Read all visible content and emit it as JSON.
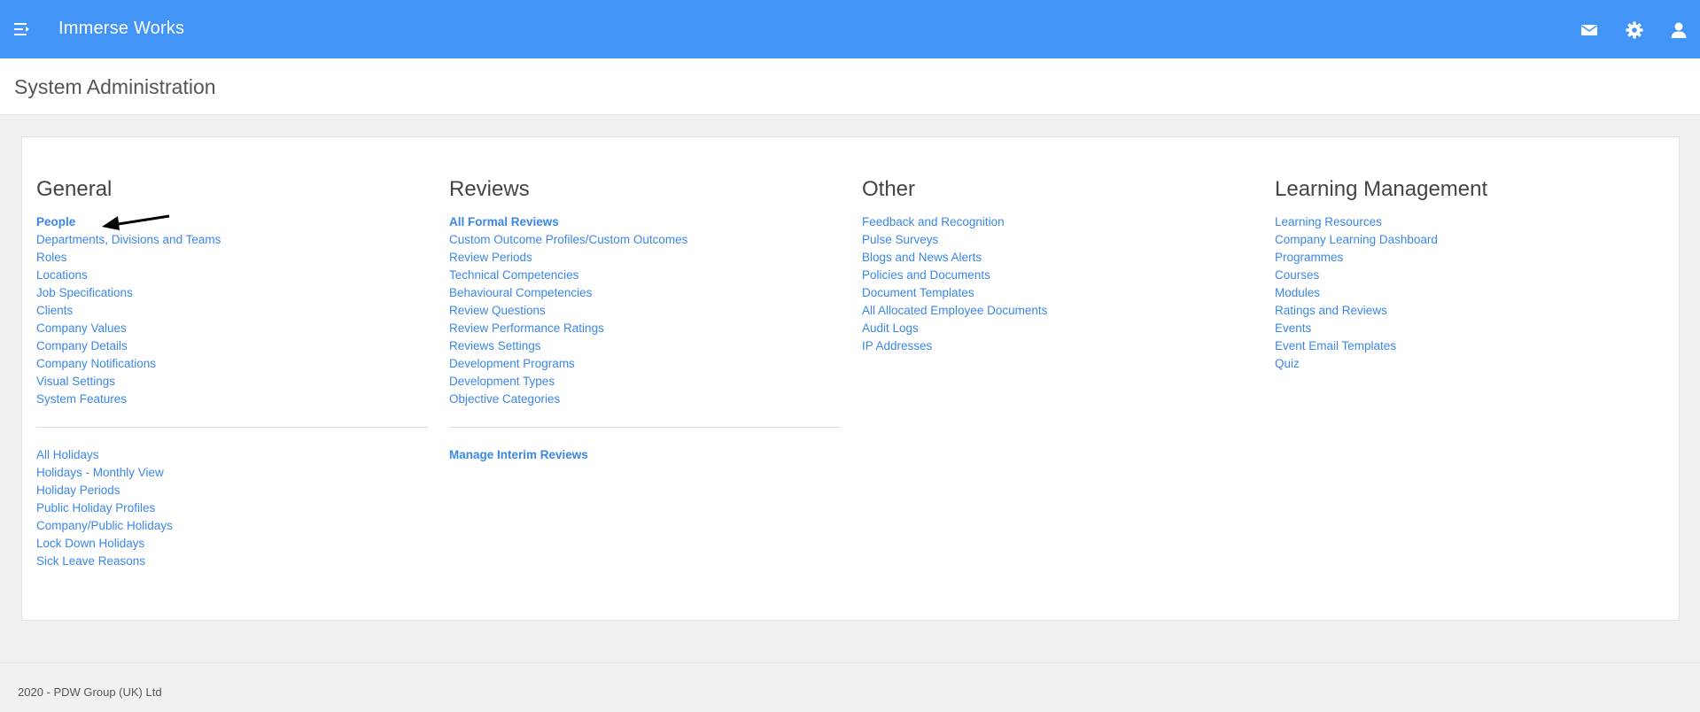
{
  "header": {
    "app_title": "Immerse Works",
    "icons": [
      "menu-icon",
      "mail-icon",
      "gear-icon",
      "user-icon"
    ],
    "bg_color": "#4294f7"
  },
  "page": {
    "title": "System Administration"
  },
  "columns": {
    "general": {
      "heading": "General",
      "links": [
        "People",
        "Departments, Divisions and Teams",
        "Roles",
        "Locations",
        "Job Specifications",
        "Clients",
        "Company Values",
        "Company Details",
        "Company Notifications",
        "Visual Settings",
        "System Features"
      ],
      "links2": [
        "All Holidays",
        "Holidays - Monthly View",
        "Holiday Periods",
        "Public Holiday Profiles",
        "Company/Public Holidays",
        "Lock Down Holidays",
        "Sick Leave Reasons"
      ]
    },
    "reviews": {
      "heading": "Reviews",
      "links": [
        "All Formal Reviews",
        "Custom Outcome Profiles/Custom Outcomes",
        "Review Periods",
        "Technical Competencies",
        "Behavioural Competencies",
        "Review Questions",
        "Review Performance Ratings",
        "Reviews Settings",
        "Development Programs",
        "Development Types",
        "Objective Categories"
      ],
      "links2": [
        "Manage Interim Reviews"
      ]
    },
    "other": {
      "heading": "Other",
      "links": [
        "Feedback and Recognition",
        "Pulse Surveys",
        "Blogs and News Alerts",
        "Policies and Documents",
        "Document Templates",
        "All Allocated Employee Documents",
        "Audit Logs",
        "IP Addresses"
      ]
    },
    "learning": {
      "heading": "Learning Management",
      "links": [
        "Learning Resources",
        "Company Learning Dashboard",
        "Programmes",
        "Courses",
        "Modules",
        "Ratings and Reviews",
        "Events",
        "Event Email Templates",
        "Quiz"
      ]
    }
  },
  "footer": {
    "text": "2020 - PDW Group (UK) Ltd"
  },
  "colors": {
    "link": "#3b86e8",
    "background": "#f0f1f3"
  }
}
